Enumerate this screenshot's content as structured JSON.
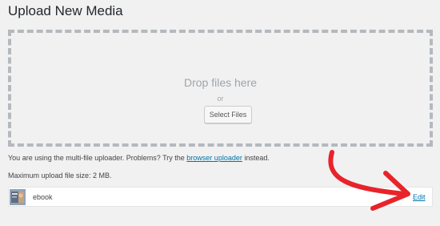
{
  "page": {
    "title": "Upload New Media"
  },
  "dropzone": {
    "drop_text": "Drop files here",
    "or_text": "or",
    "select_button_label": "Select Files"
  },
  "help": {
    "prefix": "You are using the multi-file uploader. Problems? Try the ",
    "link_label": "browser uploader",
    "suffix": " instead."
  },
  "max_upload": "Maximum upload file size: 2 MB.",
  "media_item": {
    "filename": "ebook",
    "edit_label": "Edit",
    "thumb_icon": "ebook-thumbnail-icon"
  },
  "annotation": {
    "arrow_color": "#e8232a"
  },
  "colors": {
    "background": "#f1f1f1",
    "link": "#0073aa",
    "dashed_border": "#b4b9be"
  }
}
